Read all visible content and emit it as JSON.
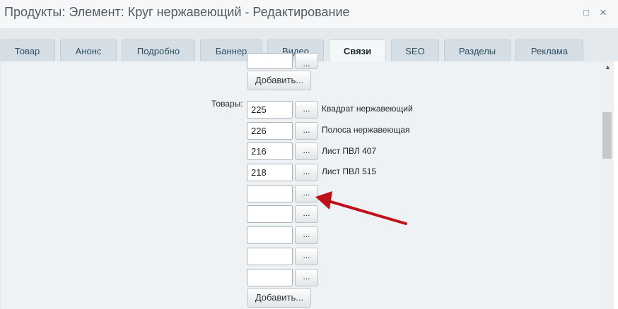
{
  "window": {
    "title": "Продукты: Элемент: Круг нержавеющий - Редактирование",
    "maximize_glyph": "□",
    "close_glyph": "×"
  },
  "tabs": [
    {
      "label": "Товар"
    },
    {
      "label": "Анонс"
    },
    {
      "label": "Подробно"
    },
    {
      "label": "Баннер"
    },
    {
      "label": "Видео"
    },
    {
      "label": "Связи",
      "active": true
    },
    {
      "label": "SEO"
    },
    {
      "label": "Разделы"
    },
    {
      "label": "Реклама"
    }
  ],
  "links": {
    "add_label": "Добавить...",
    "pick_label": "...",
    "field_label": "Товары:",
    "items": [
      {
        "id": "225",
        "name": "Квадрат нержавеющий"
      },
      {
        "id": "226",
        "name": "Полоса нержавеющая"
      },
      {
        "id": "216",
        "name": "Лист ПВЛ 407"
      },
      {
        "id": "218",
        "name": "Лист ПВЛ 515"
      },
      {
        "id": "",
        "name": ""
      },
      {
        "id": "",
        "name": ""
      },
      {
        "id": "",
        "name": ""
      },
      {
        "id": "",
        "name": ""
      },
      {
        "id": "",
        "name": ""
      }
    ]
  },
  "annotation": {
    "arrow_color": "#c0111a"
  },
  "icons": {
    "scroll_up": "scroll-up-arrow-icon"
  }
}
